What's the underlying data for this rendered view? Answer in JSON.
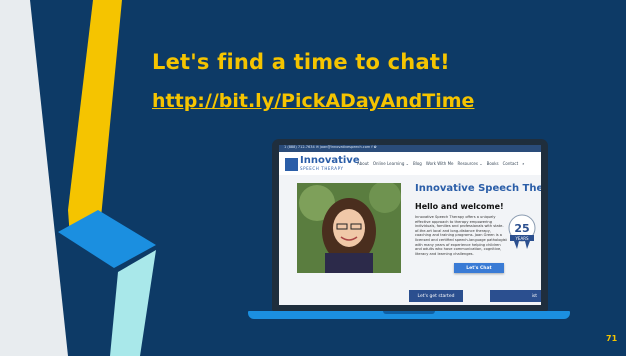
{
  "slide": {
    "headline": "Let's find a time to chat!",
    "link": "http://bit.ly/PickADayAndTime",
    "page_number": "71"
  },
  "website": {
    "topbar_text": "1 (888) 712-7634  ✉ joan@innovativespeech.com  f  ✿",
    "logo_name": "Innovative",
    "logo_sub": "SPEECH THERAPY",
    "nav": [
      "About",
      "Online Learning ⌄",
      "Blog",
      "Work With Me",
      "Resources ⌄",
      "Books",
      "Contact",
      "⌕"
    ],
    "hero_title": "Innovative Speech Therapy",
    "welcome": "Hello and welcome!",
    "body": "Innovative Speech Therapy offers a uniquely effective approach to therapy empowering individuals, families and professionals with state-of-the-art local and long-distance therapy, coaching and training programs. Joan Green is a licensed and certified speech-language pathologist with many years of experience helping children and adults who have communication, cognitive, literacy and learning challenges.",
    "badge_number": "25",
    "badge_text": "YEARS",
    "cta_primary": "Let's get started",
    "cta_secondary": "ist",
    "chat_button": "Let's Chat"
  },
  "colors": {
    "background": "#0d3a66",
    "accent": "#f5c400",
    "brand_blue": "#2b5ea8",
    "laptop_base": "#1b8fe0"
  }
}
